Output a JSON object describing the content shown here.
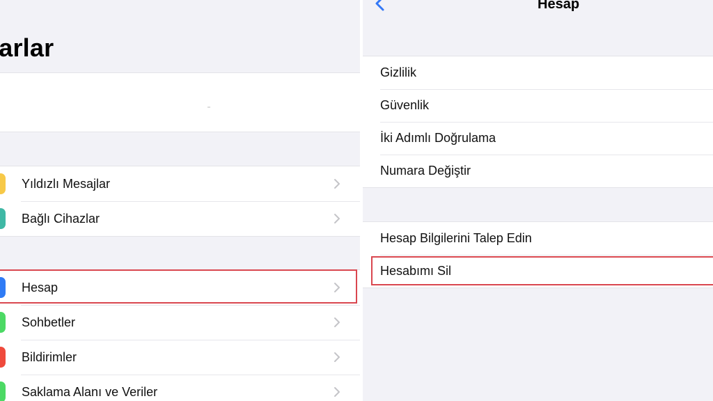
{
  "left": {
    "title": "yarlar",
    "group1": [
      {
        "label": "Yıldızlı Mesajlar",
        "icon": "star-icon",
        "color": "#f7c948"
      },
      {
        "label": "Bağlı Cihazlar",
        "icon": "laptop-icon",
        "color": "#3fb8a5"
      }
    ],
    "group2": [
      {
        "label": "Hesap",
        "icon": "key-icon",
        "color": "#2f7bf5"
      },
      {
        "label": "Sohbetler",
        "icon": "chat-icon",
        "color": "#4cd964"
      },
      {
        "label": "Bildirimler",
        "icon": "bell-icon",
        "color": "#ef4a3c"
      },
      {
        "label": "Saklama Alanı ve Veriler",
        "icon": "storage-icon",
        "color": "#4cd964"
      }
    ]
  },
  "right": {
    "title": "Hesap",
    "group1": [
      "Gizlilik",
      "Güvenlik",
      "İki Adımlı Doğrulama",
      "Numara Değiştir"
    ],
    "group2": [
      "Hesap Bilgilerini Talep Edin",
      "Hesabımı Sil"
    ]
  },
  "colors": {
    "highlight": "#d9474f",
    "back_arrow": "#3478f6",
    "background": "#f2f2f7"
  }
}
